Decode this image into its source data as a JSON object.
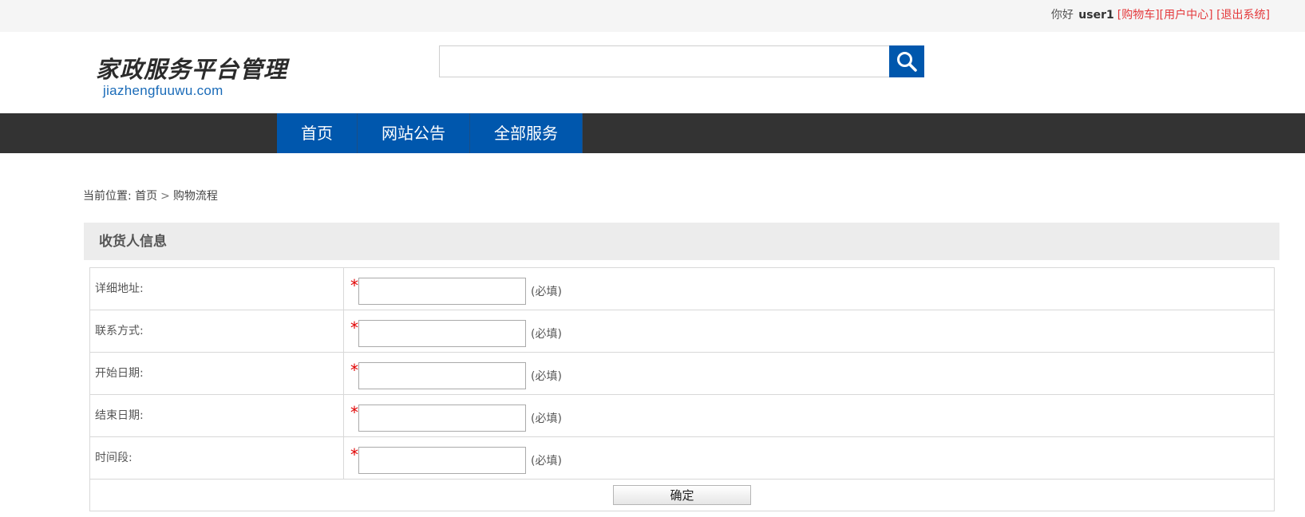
{
  "topbar": {
    "greeting": "你好",
    "username": "user1",
    "links": [
      "[购物车]",
      "[用户中心]",
      "[退出系统]"
    ]
  },
  "logo": {
    "text_cn": "家政服务平台管理",
    "text_en": "jiazhengfuuwu.com"
  },
  "search": {
    "placeholder": "",
    "button_icon": "search-icon"
  },
  "nav": {
    "items": [
      "首页",
      "网站公告",
      "全部服务"
    ]
  },
  "breadcrumb": {
    "prefix": "当前位置:",
    "home": "首页",
    "separator": ">",
    "current": "购物流程"
  },
  "section": {
    "title": "收货人信息"
  },
  "form": {
    "required_mark": "*",
    "rows": [
      {
        "label": "详细地址:",
        "value": "",
        "hint": "(必填)"
      },
      {
        "label": "联系方式:",
        "value": "",
        "hint": "(必填)"
      },
      {
        "label": "开始日期:",
        "value": "",
        "hint": "(必填)"
      },
      {
        "label": "结束日期:",
        "value": "",
        "hint": "(必填)"
      },
      {
        "label": "时间段:",
        "value": "",
        "hint": "(必填)"
      }
    ],
    "submit_label": "确定"
  },
  "colors": {
    "nav_bg": "#333333",
    "accent_blue": "#0057ad",
    "link_red": "#e4393c",
    "required_red": "#e00000"
  }
}
